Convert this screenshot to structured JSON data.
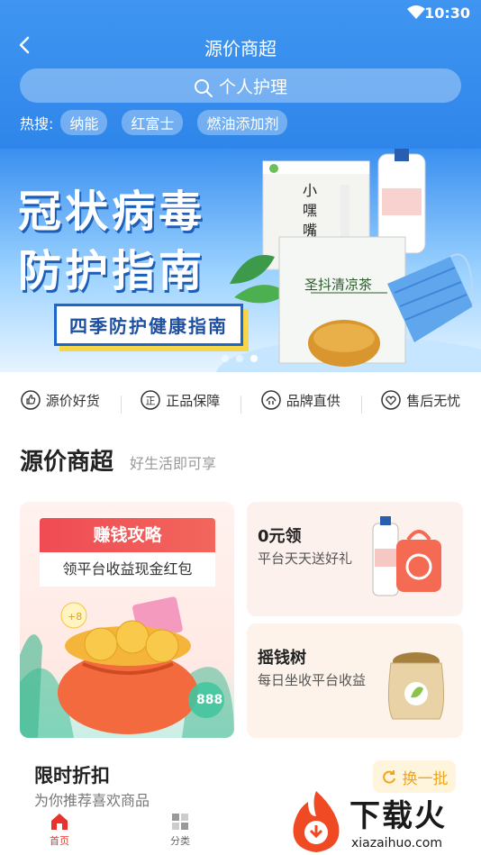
{
  "status_bar": {
    "time": "10:30"
  },
  "nav": {
    "title": "源价商超"
  },
  "search": {
    "placeholder": "个人护理"
  },
  "hot_search": {
    "label": "热搜:",
    "tags": [
      "纳能",
      "红富士",
      "燃油添加剂"
    ]
  },
  "banner": {
    "title_line1": "冠状病毒",
    "title_line2": "防护指南",
    "subtitle": "四季防护健康指南",
    "product_text": "圣抖清凉茶",
    "slide_count": 3,
    "active_slide": 3
  },
  "features": [
    {
      "icon": "thumbs-up-icon",
      "label": "源价好货"
    },
    {
      "icon": "genuine-icon",
      "label": "正品保障"
    },
    {
      "icon": "brand-icon",
      "label": "品牌直供"
    },
    {
      "icon": "heart-icon",
      "label": "售后无忧"
    }
  ],
  "section": {
    "title": "源价商超",
    "subtitle": "好生活即可享"
  },
  "cards": {
    "earn": {
      "title": "赚钱攻略",
      "desc": "领平台收益现金红包",
      "badge": "888"
    },
    "free": {
      "title": "0元领",
      "desc": "平台天天送好礼"
    },
    "tree": {
      "title": "摇钱树",
      "desc": "每日坐收平台收益"
    }
  },
  "limited": {
    "title": "限时折扣",
    "subtitle": "为你推荐喜欢商品",
    "refresh_label": "换一批"
  },
  "tabbar": {
    "home_label": "首页",
    "category_label": "分类"
  },
  "watermark": {
    "brand": "下载火",
    "url": "xiazaihuo.com"
  },
  "colors": {
    "header_blue": "#3f95f0",
    "accent_red": "#e8322e",
    "refresh_orange": "#f2a51a"
  }
}
